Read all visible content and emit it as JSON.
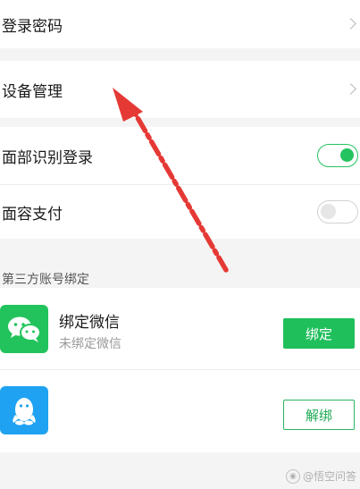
{
  "security_items": [
    {
      "label": "登录密码"
    },
    {
      "label": "设备管理"
    }
  ],
  "face_items": [
    {
      "label": "面部识别登录",
      "enabled": true
    },
    {
      "label": "面容支付",
      "enabled": false
    }
  ],
  "third_party": {
    "section_title": "第三方账号绑定",
    "accounts": [
      {
        "name": "绑定微信",
        "status": "未绑定微信",
        "button_label": "绑定",
        "icon": "wechat-icon"
      },
      {
        "name": "",
        "status": "",
        "button_label": "解绑",
        "icon": "qq-icon"
      }
    ]
  },
  "watermark": {
    "text": "@悟空问答"
  },
  "colors": {
    "accent_green": "#1fbf5c",
    "annotation_red": "#e53935",
    "wechat_green": "#22c35c",
    "qq_blue": "#1fa2f2"
  }
}
